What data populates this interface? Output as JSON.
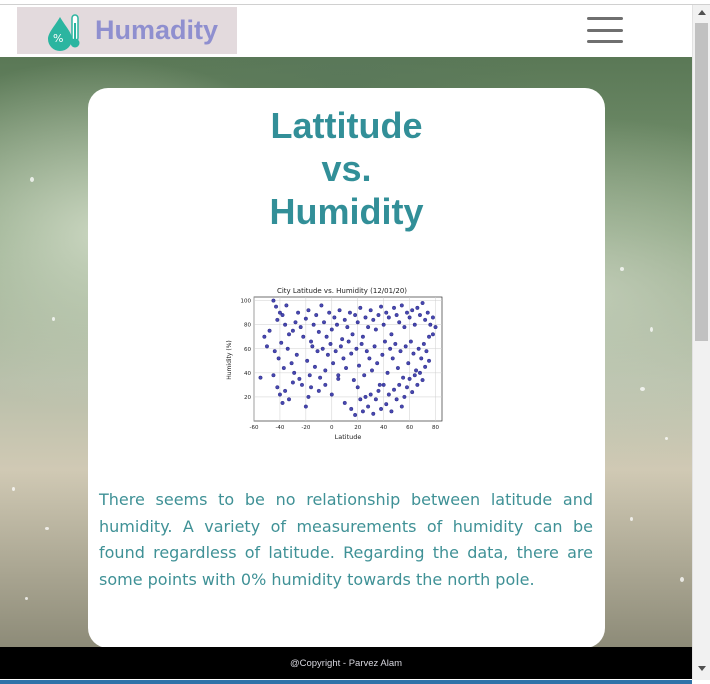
{
  "brand": {
    "name": "Humadity",
    "icon": "humidity-thermometer-icon"
  },
  "nav": {
    "menu_icon": "hamburger-menu-icon"
  },
  "page": {
    "title_lines": [
      "Lattitude",
      "vs.",
      "Humidity"
    ],
    "description": "There seems to be no relationship between latitude and humidity. A variety of measurements of humidity can be found regardless of latitude. Regarding the data, there are some points with 0% humidity towards the north pole."
  },
  "footer": {
    "text": "@Copyright - Parvez Alam"
  },
  "colors": {
    "accent": "#328f98",
    "brand_text": "#8f8fcf",
    "points": "#1a1a9c"
  },
  "chart_data": {
    "type": "scatter",
    "title": "City Latitude vs. Humidity (12/01/20)",
    "xlabel": "Latitude",
    "ylabel": "Humidity (%)",
    "xlim": [
      -60,
      85
    ],
    "ylim": [
      0,
      103
    ],
    "xticks": [
      -60,
      -40,
      -20,
      0,
      20,
      40,
      60,
      80
    ],
    "yticks": [
      20,
      40,
      60,
      80,
      100
    ],
    "grid": true,
    "points": [
      [
        -45,
        100
      ],
      [
        -43,
        95
      ],
      [
        -40,
        90
      ],
      [
        -42,
        84
      ],
      [
        -38,
        88
      ],
      [
        -36,
        80
      ],
      [
        -35,
        96
      ],
      [
        -33,
        72
      ],
      [
        -30,
        75
      ],
      [
        -28,
        82
      ],
      [
        -26,
        90
      ],
      [
        -24,
        78
      ],
      [
        -22,
        70
      ],
      [
        -20,
        85
      ],
      [
        -18,
        92
      ],
      [
        -16,
        66
      ],
      [
        -14,
        80
      ],
      [
        -12,
        88
      ],
      [
        -10,
        74
      ],
      [
        -8,
        96
      ],
      [
        -6,
        82
      ],
      [
        -4,
        70
      ],
      [
        -2,
        90
      ],
      [
        0,
        76
      ],
      [
        2,
        86
      ],
      [
        4,
        80
      ],
      [
        6,
        92
      ],
      [
        8,
        68
      ],
      [
        10,
        84
      ],
      [
        12,
        78
      ],
      [
        14,
        90
      ],
      [
        16,
        72
      ],
      [
        18,
        88
      ],
      [
        20,
        82
      ],
      [
        22,
        94
      ],
      [
        24,
        70
      ],
      [
        26,
        86
      ],
      [
        28,
        78
      ],
      [
        30,
        92
      ],
      [
        32,
        84
      ],
      [
        34,
        76
      ],
      [
        36,
        88
      ],
      [
        38,
        95
      ],
      [
        40,
        80
      ],
      [
        42,
        90
      ],
      [
        44,
        86
      ],
      [
        46,
        72
      ],
      [
        48,
        94
      ],
      [
        50,
        88
      ],
      [
        52,
        82
      ],
      [
        54,
        96
      ],
      [
        56,
        78
      ],
      [
        58,
        90
      ],
      [
        60,
        86
      ],
      [
        62,
        92
      ],
      [
        64,
        80
      ],
      [
        66,
        94
      ],
      [
        68,
        88
      ],
      [
        70,
        98
      ],
      [
        72,
        84
      ],
      [
        74,
        90
      ],
      [
        76,
        80
      ],
      [
        78,
        86
      ],
      [
        -52,
        70
      ],
      [
        -50,
        62
      ],
      [
        -48,
        75
      ],
      [
        -44,
        58
      ],
      [
        -41,
        52
      ],
      [
        -39,
        65
      ],
      [
        -37,
        44
      ],
      [
        -34,
        60
      ],
      [
        -31,
        48
      ],
      [
        -29,
        40
      ],
      [
        -27,
        55
      ],
      [
        -25,
        35
      ],
      [
        -23,
        30
      ],
      [
        -19,
        50
      ],
      [
        -17,
        38
      ],
      [
        -15,
        62
      ],
      [
        -13,
        45
      ],
      [
        -11,
        58
      ],
      [
        -9,
        36
      ],
      [
        -7,
        60
      ],
      [
        -5,
        42
      ],
      [
        -3,
        55
      ],
      [
        -1,
        64
      ],
      [
        1,
        48
      ],
      [
        3,
        58
      ],
      [
        5,
        38
      ],
      [
        7,
        62
      ],
      [
        9,
        52
      ],
      [
        11,
        44
      ],
      [
        13,
        66
      ],
      [
        15,
        56
      ],
      [
        17,
        34
      ],
      [
        19,
        60
      ],
      [
        21,
        46
      ],
      [
        23,
        64
      ],
      [
        25,
        38
      ],
      [
        27,
        58
      ],
      [
        29,
        52
      ],
      [
        31,
        42
      ],
      [
        33,
        62
      ],
      [
        35,
        48
      ],
      [
        37,
        30
      ],
      [
        39,
        55
      ],
      [
        41,
        66
      ],
      [
        43,
        40
      ],
      [
        45,
        60
      ],
      [
        47,
        52
      ],
      [
        49,
        64
      ],
      [
        51,
        44
      ],
      [
        53,
        58
      ],
      [
        55,
        36
      ],
      [
        57,
        62
      ],
      [
        59,
        48
      ],
      [
        61,
        66
      ],
      [
        63,
        56
      ],
      [
        65,
        42
      ],
      [
        67,
        60
      ],
      [
        69,
        52
      ],
      [
        71,
        64
      ],
      [
        73,
        58
      ],
      [
        75,
        70
      ],
      [
        -55,
        36
      ],
      [
        -45,
        38
      ],
      [
        -42,
        28
      ],
      [
        -40,
        22
      ],
      [
        -38,
        15
      ],
      [
        -36,
        25
      ],
      [
        -33,
        18
      ],
      [
        -30,
        32
      ],
      [
        -20,
        12
      ],
      [
        -18,
        20
      ],
      [
        -16,
        28
      ],
      [
        -10,
        25
      ],
      [
        -5,
        30
      ],
      [
        0,
        22
      ],
      [
        5,
        35
      ],
      [
        10,
        15
      ],
      [
        15,
        10
      ],
      [
        18,
        5
      ],
      [
        20,
        28
      ],
      [
        22,
        18
      ],
      [
        24,
        8
      ],
      [
        26,
        20
      ],
      [
        28,
        12
      ],
      [
        30,
        22
      ],
      [
        32,
        6
      ],
      [
        34,
        18
      ],
      [
        36,
        25
      ],
      [
        38,
        10
      ],
      [
        40,
        30
      ],
      [
        42,
        14
      ],
      [
        44,
        22
      ],
      [
        46,
        8
      ],
      [
        48,
        26
      ],
      [
        50,
        18
      ],
      [
        52,
        30
      ],
      [
        54,
        12
      ],
      [
        56,
        20
      ],
      [
        58,
        28
      ],
      [
        60,
        35
      ],
      [
        62,
        24
      ],
      [
        64,
        38
      ],
      [
        66,
        30
      ],
      [
        68,
        40
      ],
      [
        70,
        34
      ],
      [
        72,
        45
      ],
      [
        75,
        50
      ],
      [
        78,
        72
      ],
      [
        80,
        78
      ]
    ]
  }
}
